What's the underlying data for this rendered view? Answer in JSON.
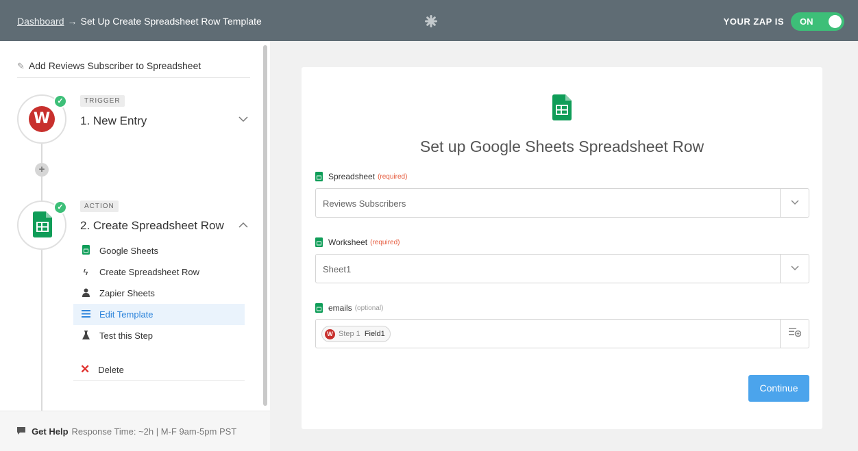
{
  "header": {
    "breadcrumb_link": "Dashboard",
    "breadcrumb_arrow": "→",
    "breadcrumb_current": "Set Up Create Spreadsheet Row Template",
    "zap_status_label": "YOUR ZAP IS",
    "zap_toggle_state": "ON"
  },
  "sidebar": {
    "zap_name": "Add Reviews Subscriber to Spreadsheet",
    "trigger": {
      "tag": "TRIGGER",
      "title": "1. New Entry",
      "app_icon_letter": "W"
    },
    "action": {
      "tag": "ACTION",
      "title": "2. Create Spreadsheet Row",
      "substeps": [
        {
          "label": "Google Sheets",
          "icon": "google-sheets-icon"
        },
        {
          "label": "Create Spreadsheet Row",
          "icon": "lightning-icon"
        },
        {
          "label": "Zapier Sheets",
          "icon": "person-icon"
        },
        {
          "label": "Edit Template",
          "icon": "list-icon",
          "active": true
        },
        {
          "label": "Test this Step",
          "icon": "flask-icon"
        }
      ],
      "delete_label": "Delete"
    },
    "help": {
      "label": "Get Help",
      "response_time": "Response Time: ~2h | M-F 9am-5pm PST"
    }
  },
  "main": {
    "title": "Set up Google Sheets Spreadsheet Row",
    "fields": {
      "spreadsheet": {
        "label": "Spreadsheet",
        "qualifier": "(required)",
        "value": "Reviews Subscribers"
      },
      "worksheet": {
        "label": "Worksheet",
        "qualifier": "(required)",
        "value": "Sheet1"
      },
      "emails": {
        "label": "emails",
        "qualifier": "(optional)",
        "pill_step": "Step 1",
        "pill_field": "Field1",
        "pill_icon_letter": "W"
      }
    },
    "continue_label": "Continue"
  },
  "colors": {
    "header_bg": "#5f6c74",
    "toggle_on": "#3dbf78",
    "continue_button": "#4ba4ec",
    "sheets_green": "#0f9d58",
    "wufoo_red": "#c8302d",
    "required_text": "#e55a3c"
  }
}
